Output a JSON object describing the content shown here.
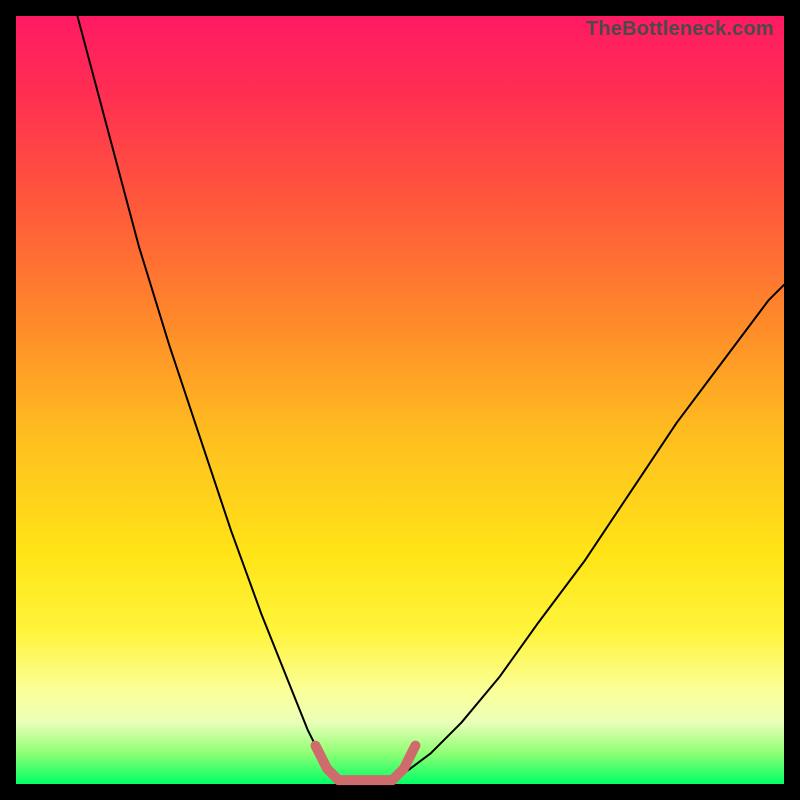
{
  "watermark": "TheBottleneck.com",
  "chart_data": {
    "type": "line",
    "title": "",
    "xlabel": "",
    "ylabel": "",
    "xlim": [
      0,
      100
    ],
    "ylim": [
      0,
      100
    ],
    "grid": false,
    "series": [
      {
        "name": "left-curve",
        "x": [
          8,
          12,
          16,
          20,
          24,
          28,
          32,
          36,
          38,
          40,
          42
        ],
        "y": [
          100,
          85,
          70,
          57,
          45,
          33,
          22,
          12,
          7,
          3,
          1
        ],
        "color": "#000000",
        "stroke_width": 2
      },
      {
        "name": "right-curve",
        "x": [
          50,
          54,
          58,
          63,
          68,
          74,
          80,
          86,
          92,
          98,
          100
        ],
        "y": [
          1,
          4,
          8,
          14,
          21,
          29,
          38,
          47,
          55,
          63,
          65
        ],
        "color": "#000000",
        "stroke_width": 2
      },
      {
        "name": "bottom-bracket",
        "x": [
          39,
          40.5,
          42,
          46,
          49,
          50.5,
          52
        ],
        "y": [
          5,
          2,
          0.5,
          0.5,
          0.5,
          2,
          5
        ],
        "color": "#ce6b6c",
        "stroke_width": 10
      }
    ]
  }
}
